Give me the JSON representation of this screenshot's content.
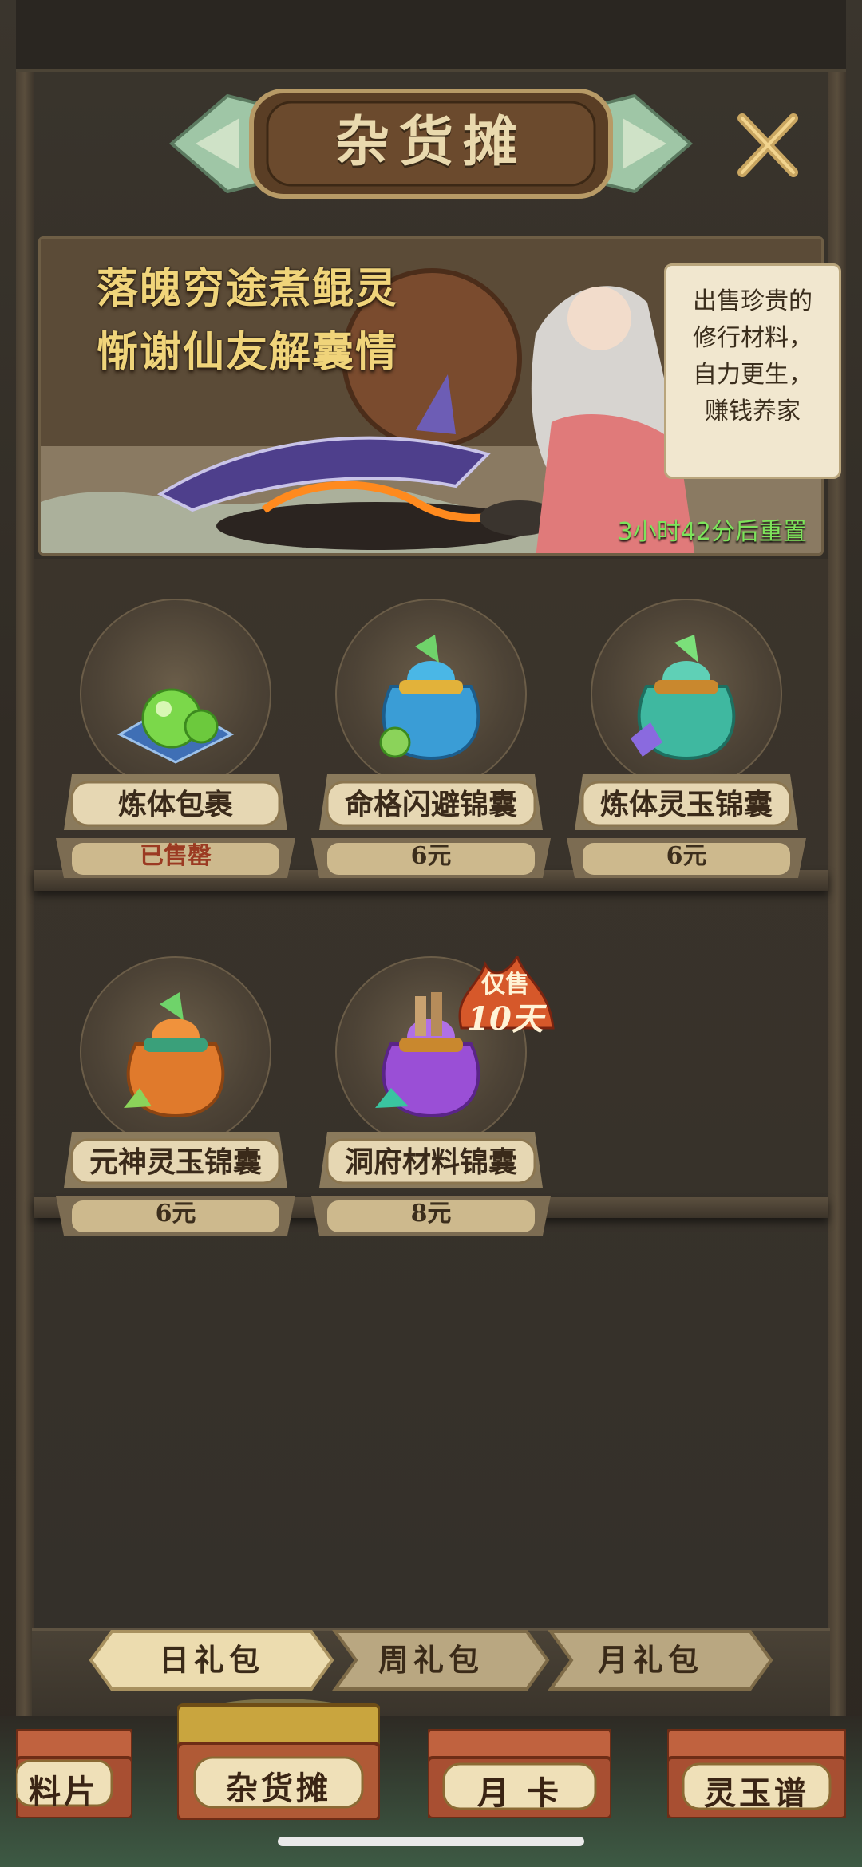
{
  "header": {
    "title": "杂货摊"
  },
  "banner": {
    "slogan_line1": "落魄穷途煮鲲灵",
    "slogan_line2": "惭谢仙友解囊情",
    "speech_lines": [
      "出售珍贵的",
      "修行材料，",
      "自力更生，",
      "赚钱养家"
    ],
    "reset_timer": "3小时42分后重置"
  },
  "items": [
    {
      "name": "炼体包裹",
      "price": "已售罄",
      "sold_out": true,
      "icon": "green-pearls-icon"
    },
    {
      "name": "命格闪避锦囊",
      "price": "6元",
      "sold_out": false,
      "icon": "blue-pouch-icon"
    },
    {
      "name": "炼体灵玉锦囊",
      "price": "6元",
      "sold_out": false,
      "icon": "teal-pouch-icon"
    },
    {
      "name": "元神灵玉锦囊",
      "price": "6元",
      "sold_out": false,
      "icon": "orange-pouch-icon"
    },
    {
      "name": "洞府材料锦囊",
      "price": "8元",
      "sold_out": false,
      "icon": "purple-pouch-icon"
    }
  ],
  "limited_badge": {
    "line1": "仅售",
    "line2": "10天"
  },
  "tabs": [
    {
      "label": "日礼包",
      "active": true
    },
    {
      "label": "周礼包",
      "active": false
    },
    {
      "label": "月礼包",
      "active": false
    }
  ],
  "bottom_nav": [
    {
      "label": "料片",
      "active": false
    },
    {
      "label": "杂货摊",
      "active": true
    },
    {
      "label": "月 卡",
      "active": false
    },
    {
      "label": "灵玉谱",
      "active": false
    }
  ],
  "colors": {
    "gold_text": "#f0d47a",
    "timer_green": "#7de35b",
    "sold_out_red": "#9b3a22",
    "parchment": "#e6d7b3"
  }
}
